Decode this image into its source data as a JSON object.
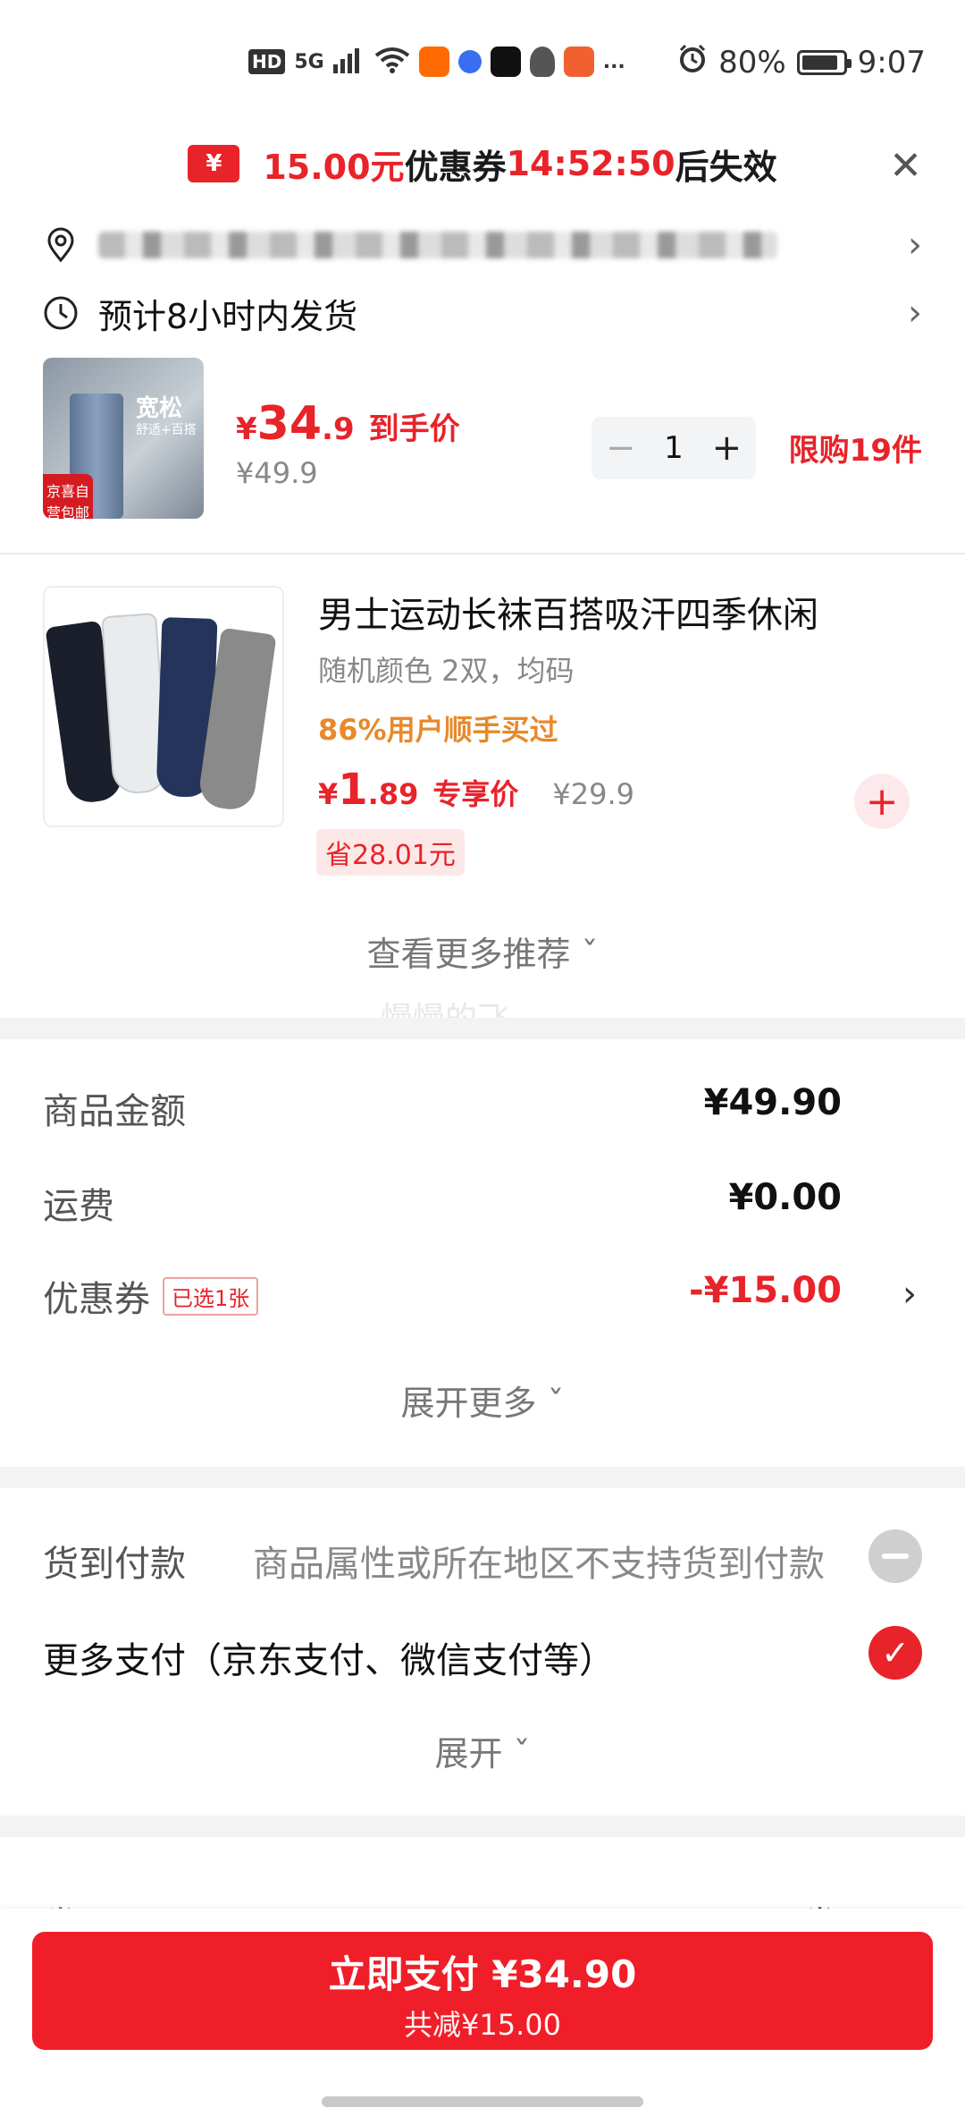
{
  "status_bar": {
    "left_chips": [
      "HD",
      "5G",
      "..."
    ],
    "battery": "80%",
    "battery_level": 0.8,
    "time": "9:07",
    "icons": [
      "signal-icon",
      "wifi-icon",
      "app-icon",
      "tiktok-icon",
      "qq-icon",
      "alarm-icon",
      "battery-icon"
    ]
  },
  "coupon_banner": {
    "icon_symbol": "¥",
    "amount": "15.00元",
    "coupon_text": "优惠券",
    "countdown": "14:52:50",
    "suffix": "后失效",
    "close_symbol": "✕"
  },
  "shipping": {
    "estimate": "预计8小时内发货"
  },
  "main_product": {
    "image_tag": "宽松",
    "image_sub": "舒适+百搭",
    "image_badge": "京喜自营包邮",
    "currency": "¥",
    "price_int": "34",
    "price_dec": ".9",
    "price_label": "到手价",
    "original_price": "¥49.9",
    "qty_minus": "−",
    "qty": "1",
    "qty_plus": "+",
    "limit": "限购19件"
  },
  "recommended": {
    "title": "男士运动长袜百搭吸汗四季休闲",
    "spec": "随机颜色 2双，均码",
    "bought": "86%用户顺手买过",
    "currency": "¥",
    "price_int": "1",
    "price_dec": ".89",
    "price_label": "专享价",
    "original_price": "¥29.9",
    "save": "省28.01元",
    "add_symbol": "+"
  },
  "see_more": "查看更多推荐 ˇ",
  "watermark": "慢慢的飞",
  "summary": {
    "goods_label": "商品金额",
    "goods_value": "¥49.90",
    "shipping_label": "运费",
    "shipping_value": "¥0.00",
    "coupon_label": "优惠券",
    "coupon_tag": "已选1张",
    "coupon_value": "-¥15.00",
    "chevron": "›",
    "expand_more": "展开更多 ˇ"
  },
  "payment": {
    "cod_label": "货到付款",
    "cod_desc": "商品属性或所在地区不支持货到付款",
    "more_label": "更多支付（京东支付、微信支付等）",
    "check_symbol": "✓",
    "expand": "展开 ˇ"
  },
  "invoice": {
    "label": "发票",
    "value": "不开发票",
    "chevron": "›"
  },
  "pay_button": {
    "main": "立即支付 ¥34.90",
    "sub": "共减¥15.00"
  },
  "colors": {
    "accent_red": "#e8232a",
    "orange": "#e8892a"
  }
}
